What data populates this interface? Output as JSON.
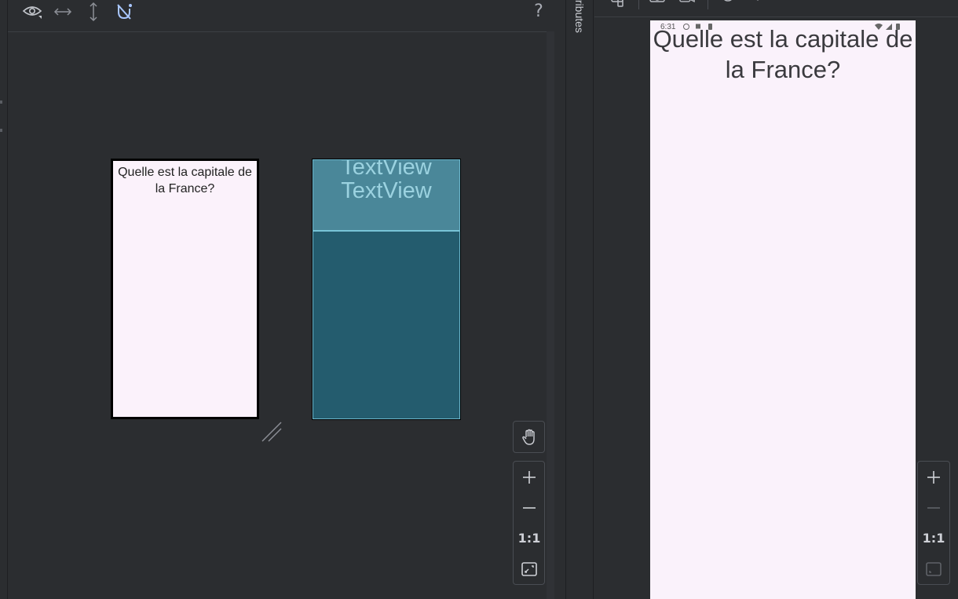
{
  "editor": {
    "toolbar": {
      "eye_icon": "eye-icon",
      "horizontal_icon": "horizontal-arrows-icon",
      "vertical_icon": "vertical-arrows-icon",
      "constraints_icon": "magnet-off-icon",
      "help_label": "?"
    },
    "design_preview": {
      "text": "Quelle est la capitale de la France?"
    },
    "blueprint_preview": {
      "label_1": "TextView",
      "label_2": "TextView"
    },
    "zoom": {
      "zoom_in": "+",
      "zoom_out": "—",
      "one_to_one": "1:1"
    }
  },
  "attributes_panel": {
    "label": "tributes"
  },
  "running_device": {
    "status_time": "6:31",
    "screen_text": "Quelle est la capitale de la France?",
    "zoom": {
      "zoom_in": "+",
      "zoom_out": "—",
      "one_to_one": "1:1"
    }
  },
  "colors": {
    "ide_background": "#2b2d30",
    "design_screen": "#fbf2fb",
    "blueprint_screen": "#245c6e",
    "blueprint_textview": "#4a8799",
    "blueprint_text": "#9bd2e0",
    "device_screen": "#faf2fb"
  }
}
